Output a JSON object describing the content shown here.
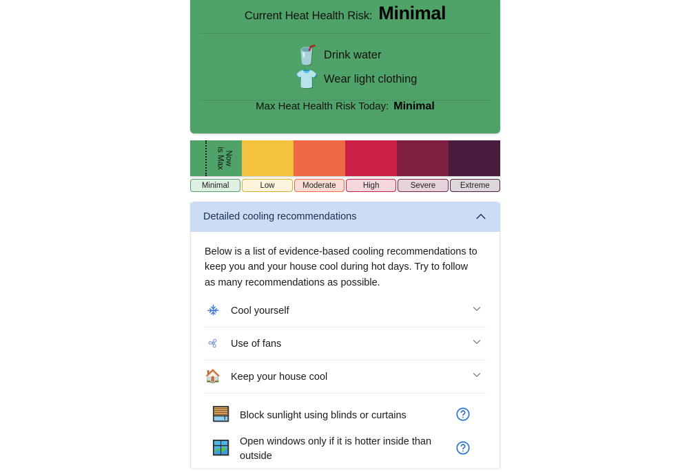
{
  "risk_card": {
    "current_label": "Current Heat Health Risk:",
    "current_value": "Minimal",
    "advice": [
      {
        "icon": "water-bottle-icon",
        "emoji": "🥤",
        "text": "Drink water"
      },
      {
        "icon": "t-shirt-icon",
        "emoji": "👕",
        "text": "Wear light clothing"
      }
    ],
    "max_label": "Max Heat Health Risk Today:",
    "max_value": "Minimal",
    "background_color": "#4fa368"
  },
  "scale": {
    "now_marker_label": "Now\nis Max",
    "now_marker_line1": "Now",
    "now_marker_line2": "is Max",
    "segments": [
      {
        "label": "Minimal",
        "bar_color": "#4fa368",
        "chip_bg": "#dff0e3",
        "chip_border": "#4fa368"
      },
      {
        "label": "Low",
        "bar_color": "#f3c33f",
        "chip_bg": "#fdf4dc",
        "chip_border": "#e0aa2a"
      },
      {
        "label": "Moderate",
        "bar_color": "#ef6843",
        "chip_bg": "#fbdcd4",
        "chip_border": "#ef6843"
      },
      {
        "label": "High",
        "bar_color": "#cb1f43",
        "chip_bg": "#f4d7dd",
        "chip_border": "#cb1f43"
      },
      {
        "label": "Severe",
        "bar_color": "#7e1f41",
        "chip_bg": "#e6d2d9",
        "chip_border": "#7e1f41"
      },
      {
        "label": "Extreme",
        "bar_color": "#4a1b3c",
        "chip_bg": "#ddd7dc",
        "chip_border": "#4a1b3c"
      }
    ]
  },
  "detailed": {
    "header_title": "Detailed cooling recommendations",
    "header_icon": "chevron-up-icon",
    "header_bg": "#ccdcf5",
    "intro": "Below is a list of evidence-based cooling recommendations to keep you and your house cool during hot days. Try to follow as many recommendations as possible.",
    "accordions": [
      {
        "icon": "snowflake-icon",
        "emoji": "❄",
        "label": "Cool yourself",
        "chevron": "chevron-down-icon"
      },
      {
        "icon": "fan-icon",
        "emoji": "🌀",
        "label": "Use of fans",
        "chevron": "chevron-down-icon"
      },
      {
        "icon": "house-icon",
        "emoji": "🏠",
        "label": "Keep your house cool",
        "chevron": "chevron-down-icon"
      }
    ],
    "recommendations": [
      {
        "icon": "blinds-icon",
        "emoji": "🪟",
        "text": "Block sunlight using blinds or curtains",
        "help_icon": "help-circle-icon"
      },
      {
        "icon": "window-icon",
        "emoji": "🖼",
        "text": "Open windows only if it is hotter inside than outside",
        "help_icon": "help-circle-icon"
      }
    ]
  }
}
